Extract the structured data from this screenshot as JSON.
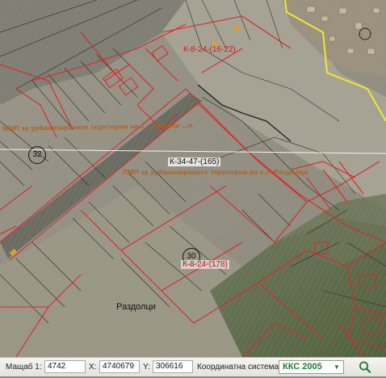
{
  "map": {
    "parcel_labels": [
      {
        "id": "k24-top",
        "text": "К-8-24-(16-22)"
      },
      {
        "id": "k24-mid",
        "text": "К-34-47-(165)"
      },
      {
        "id": "k24-low",
        "text": "К-8-24-(178)"
      }
    ],
    "zone_labels": [
      {
        "id": "mmp-upper",
        "text": "ММП за урбанизираните територии на с.с. Печеле ...н"
      },
      {
        "id": "mmp-lower",
        "text": "ПМП за урбанизираните територии на с.с. Раздолци"
      }
    ],
    "circle_labels": [
      {
        "id": "c32",
        "text": "32"
      },
      {
        "id": "c30",
        "text": "30"
      }
    ],
    "place_name": "Раздолци",
    "colors": {
      "parcel": "#d8282a",
      "boundary": "#f2e82a",
      "grid": "#222222",
      "parcel_text": "#d21a1a",
      "zone_text": "#b4601a"
    }
  },
  "statusbar": {
    "scale_label": "Мащаб 1:",
    "scale_value": "4742",
    "x_label": "X:",
    "x_value": "4740679",
    "y_label": "Y:",
    "y_value": "306616",
    "coord_label": "Координатна система:",
    "coord_value": "ККС 2005",
    "dropdown_icon": "chevron-down-icon",
    "search_icon": "search-icon",
    "accent": "#1c7a2e"
  }
}
